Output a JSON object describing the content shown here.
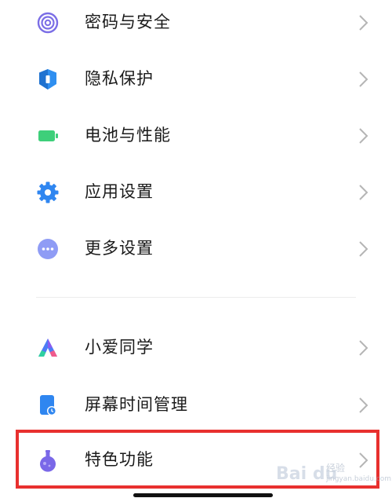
{
  "settings_group_1": [
    {
      "label": "密码与安全",
      "icon": "fingerprint-icon"
    },
    {
      "label": "隐私保护",
      "icon": "privacy-shield-icon"
    },
    {
      "label": "电池与性能",
      "icon": "battery-icon"
    },
    {
      "label": "应用设置",
      "icon": "gear-icon"
    },
    {
      "label": "更多设置",
      "icon": "more-dots-icon"
    }
  ],
  "settings_group_2": [
    {
      "label": "小爱同学",
      "icon": "xiaoai-assistant-icon"
    },
    {
      "label": "屏幕时间管理",
      "icon": "screen-time-icon"
    },
    {
      "label": "特色功能",
      "icon": "special-features-flask-icon"
    }
  ],
  "watermark": {
    "brand": "Bai du",
    "sub": "经验",
    "site": "jingyan.baidu.com"
  },
  "colors": {
    "highlight_border": "#e8302e",
    "fingerprint": "#7b6ee6",
    "privacy": "#2f8ff0",
    "battery": "#3ecf7a",
    "gear": "#2f86f0",
    "more": "#8f9cf5",
    "flask": "#7a68e8"
  }
}
